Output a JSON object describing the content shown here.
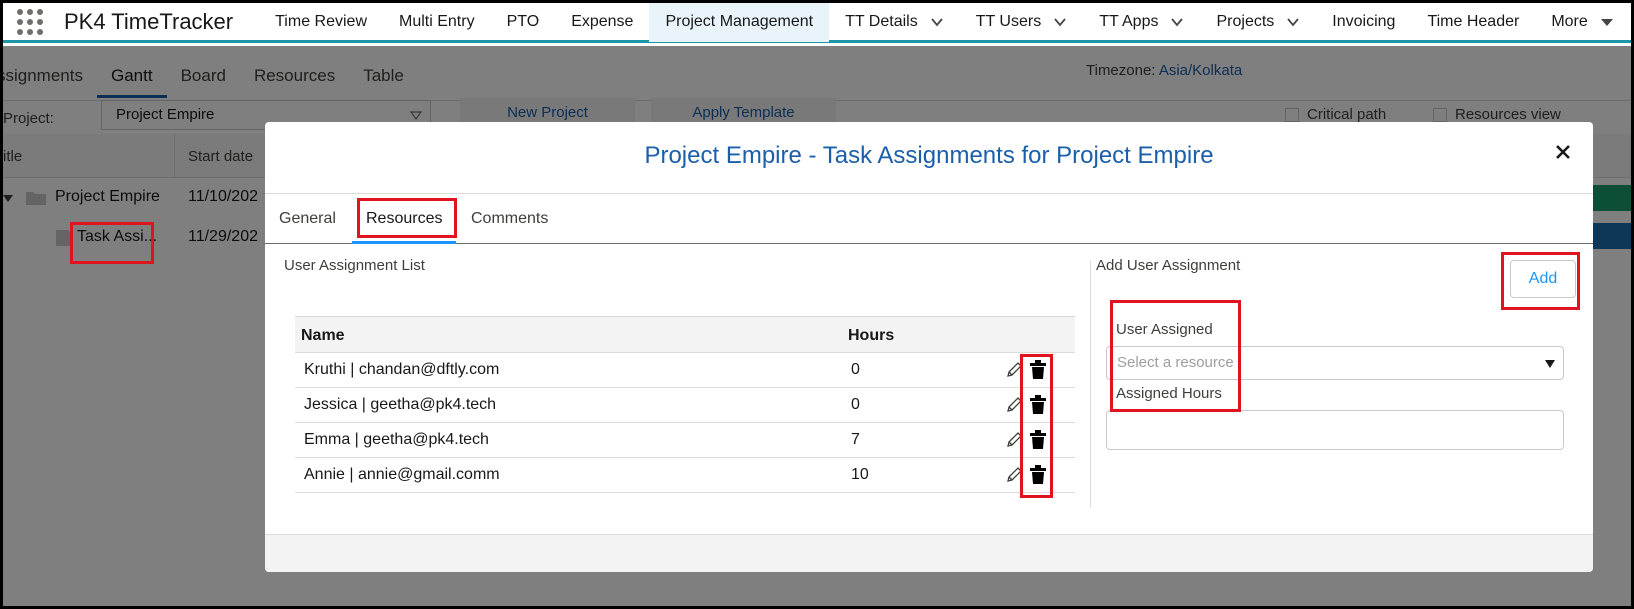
{
  "app": {
    "name": "PK4 TimeTracker"
  },
  "nav": {
    "items": [
      {
        "label": "Time Review"
      },
      {
        "label": "Multi Entry"
      },
      {
        "label": "PTO"
      },
      {
        "label": "Expense"
      },
      {
        "label": "Project Management"
      },
      {
        "label": "TT Details"
      },
      {
        "label": "TT Users"
      },
      {
        "label": "TT Apps"
      },
      {
        "label": "Projects"
      },
      {
        "label": "Invoicing"
      },
      {
        "label": "Time Header"
      },
      {
        "label": "More"
      }
    ]
  },
  "page": {
    "subtabs": [
      "ssignments",
      "Gantt",
      "Board",
      "Resources",
      "Table"
    ],
    "active_subtab": "Gantt",
    "timezone_label": "Timezone:",
    "timezone_value": "Asia/Kolkata",
    "project_label": "Project:",
    "project_value": "Project Empire",
    "new_project_label": "New Project",
    "apply_template_label": "Apply Template",
    "critical_path_label": "Critical path",
    "resources_view_label": "Resources view",
    "grid": {
      "col_title": "itle",
      "col_start": "Start date",
      "rows": [
        {
          "name": "Project Empire",
          "date": "11/10/202"
        },
        {
          "name": "Task Assi...",
          "date": "11/29/202"
        }
      ]
    }
  },
  "modal": {
    "title": "Project Empire - Task Assignments for Project Empire",
    "tabs": [
      "General",
      "Resources",
      "Comments"
    ],
    "active_tab": "Resources",
    "list_title": "User Assignment List",
    "add_title": "Add User Assignment",
    "add_button": "Add",
    "table": {
      "headers": [
        "Name",
        "Hours"
      ],
      "rows": [
        {
          "name": "Kruthi | chandan@dftly.com",
          "hours": "0"
        },
        {
          "name": "Jessica | geetha@pk4.tech",
          "hours": "0"
        },
        {
          "name": "Emma | geetha@pk4.tech",
          "hours": "7"
        },
        {
          "name": "Annie | annie@gmail.comm",
          "hours": "10"
        }
      ]
    },
    "form": {
      "user_label": "User Assigned",
      "user_placeholder": "Select a resource",
      "hours_label": "Assigned Hours",
      "hours_value": ""
    }
  },
  "colors": {
    "accent": "#1b5faa",
    "nav_underline": "#1b96a8",
    "annotation": "#e0141e"
  }
}
